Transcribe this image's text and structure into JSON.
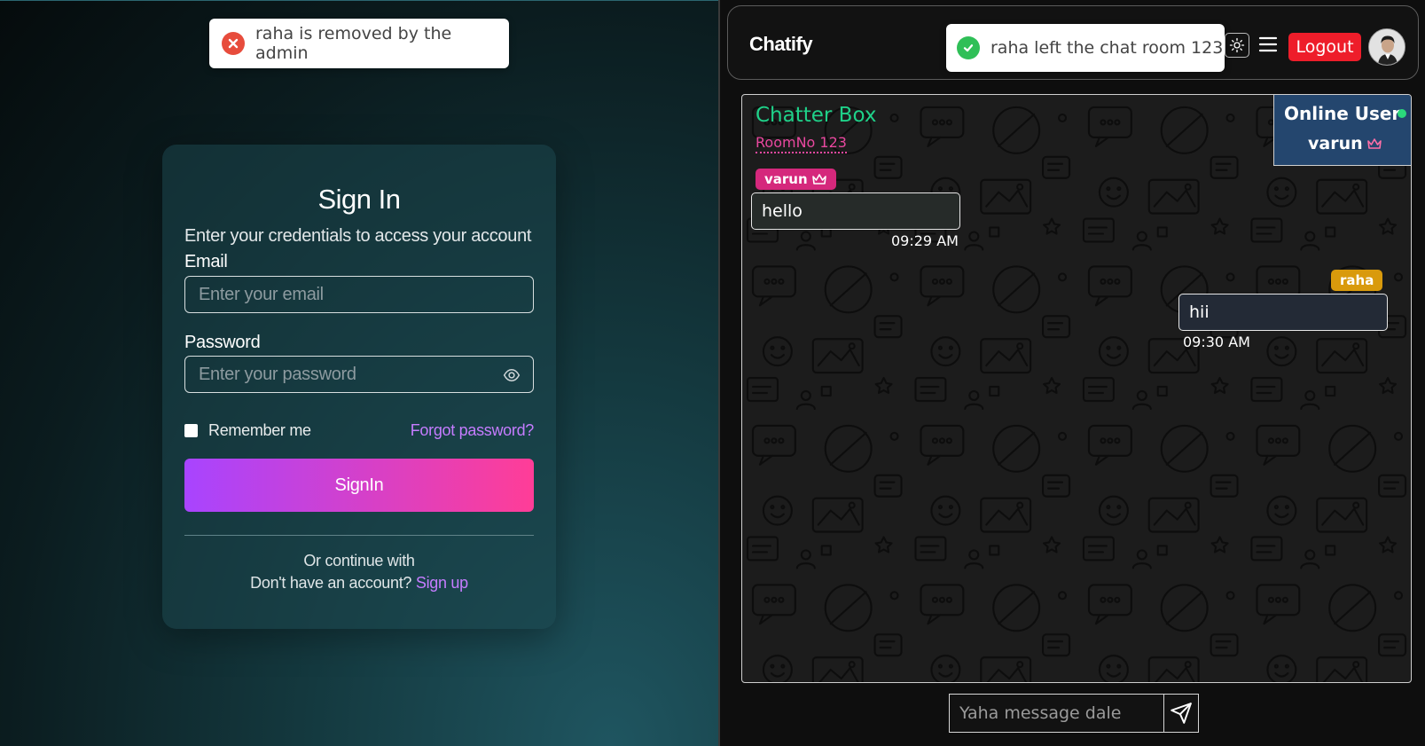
{
  "colors": {
    "accent_purple": "#a844ff",
    "accent_pink": "#ff3d97",
    "link_purple": "#c57cff",
    "chat_title_green": "#1fd189",
    "room_pink": "#e9489f",
    "logout_red": "#ee1d2a",
    "online_panel_blue": "#24466e",
    "badge_varun": "#d5287c",
    "badge_raha": "#d99a0c"
  },
  "left": {
    "toast": {
      "icon": "error-x-icon",
      "text": "raha is removed by the admin"
    },
    "signin": {
      "title": "Sign In",
      "subtitle": "Enter your credentials to access your account",
      "email_label": "Email",
      "email_placeholder": "Enter your email",
      "password_label": "Password",
      "password_placeholder": "Enter your password",
      "remember_label": "Remember me",
      "forgot_label": "Forgot password?",
      "button_label": "SignIn",
      "or_text": "Or continue with",
      "no_account_text": "Don't have an account?",
      "signup_label": "Sign up"
    }
  },
  "right": {
    "header": {
      "brand": "Chatify",
      "toast": {
        "icon": "success-check-icon",
        "text": "raha left the chat room 123"
      },
      "theme_icon": "sun-icon",
      "menu_icon": "hamburger-icon",
      "logout_label": "Logout",
      "avatar_icon": "user-avatar"
    },
    "chat": {
      "title": "Chatter Box",
      "room": "RoomNo 123",
      "online": {
        "title": "Online User",
        "users": [
          "varun"
        ]
      },
      "messages": [
        {
          "user": "varun",
          "text": "hello",
          "time": "09:29 AM",
          "side": "left",
          "admin": true
        },
        {
          "user": "raha",
          "text": "hii",
          "time": "09:30 AM",
          "side": "right",
          "admin": false
        }
      ]
    },
    "composer": {
      "placeholder": "Yaha message dale",
      "send_icon": "send-icon"
    }
  }
}
